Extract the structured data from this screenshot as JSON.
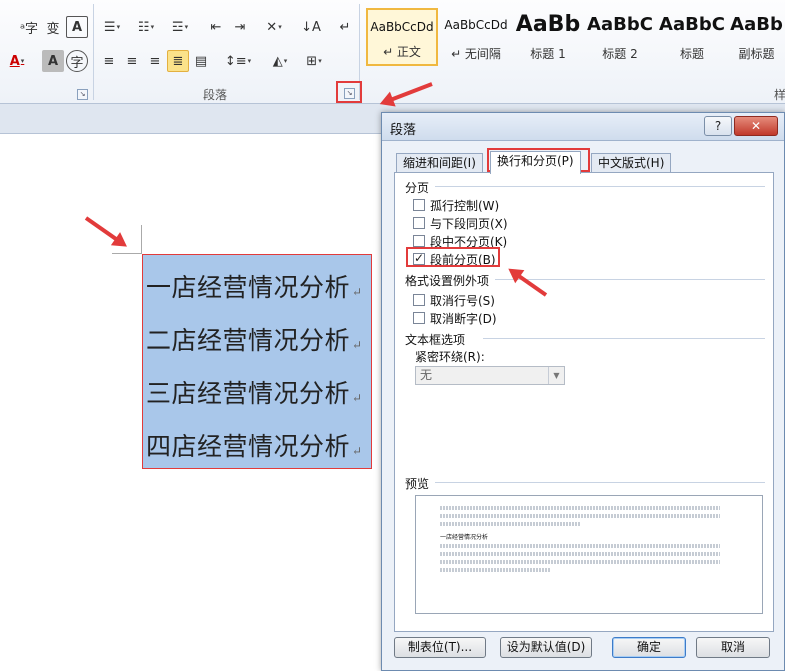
{
  "ribbon": {
    "paragraph_group_label": "段落",
    "next_group_label_partial": "样",
    "styles": [
      {
        "preview": "AaBbCcDd",
        "name": "↵ 正文"
      },
      {
        "preview": "AaBbCcDd",
        "name": "↵ 无间隔"
      },
      {
        "preview": "AaBb",
        "name": "标题 1"
      },
      {
        "preview": "AaBbC",
        "name": "标题 2"
      },
      {
        "preview": "AaBbC",
        "name": "标题"
      },
      {
        "preview": "AaBb",
        "name": "副标题"
      }
    ]
  },
  "document": {
    "lines": [
      "一店经营情况分析",
      "二店经营情况分析",
      "三店经营情况分析",
      "四店经营情况分析"
    ],
    "paragraph_mark": "↵"
  },
  "dialog": {
    "title": "段落",
    "help": "?",
    "close": "✕",
    "tabs": [
      "缩进和间距(I)",
      "换行和分页(P)",
      "中文版式(H)"
    ],
    "section_pagination": "分页",
    "pagination_options": [
      {
        "label": "孤行控制(W)",
        "checked": false
      },
      {
        "label": "与下段同页(X)",
        "checked": false
      },
      {
        "label": "段中不分页(K)",
        "checked": false
      },
      {
        "label": "段前分页(B)",
        "checked": true
      }
    ],
    "section_format_exceptions": "格式设置例外项",
    "format_options": [
      {
        "label": "取消行号(S)",
        "checked": false
      },
      {
        "label": "取消断字(D)",
        "checked": false
      }
    ],
    "section_textbox": "文本框选项",
    "tight_wrap_label": "紧密环绕(R):",
    "tight_wrap_value": "无",
    "section_preview": "预览",
    "preview_sample": "一店经营情况分析",
    "buttons": {
      "tabs": "制表位(T)...",
      "set_default": "设为默认值(D)",
      "ok": "确定",
      "cancel": "取消"
    }
  },
  "colors": {
    "highlight": "#e23b3b",
    "selection": "#a9c7ea"
  }
}
